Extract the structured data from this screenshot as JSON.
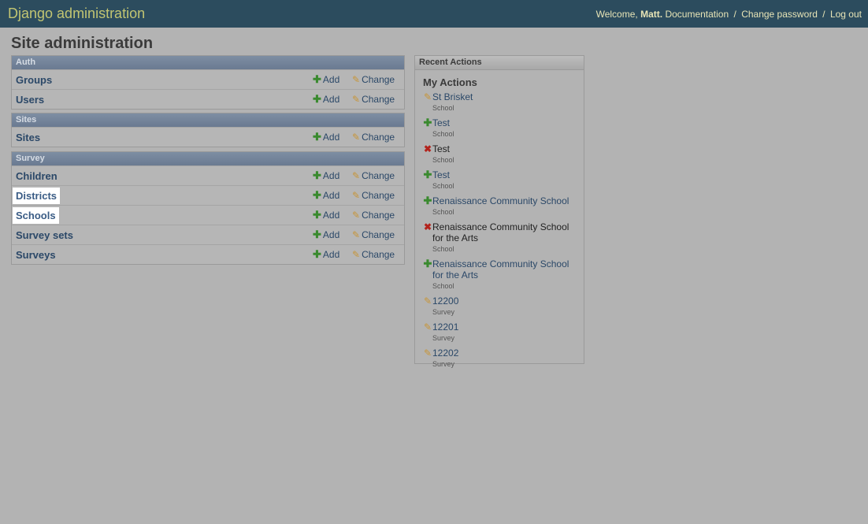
{
  "header": {
    "site_name": "Django administration",
    "welcome": "Welcome,",
    "user": "Matt.",
    "links": [
      "Documentation",
      "Change password",
      "Log out"
    ],
    "sep": "/"
  },
  "page_title": "Site administration",
  "actions": {
    "add": "Add",
    "change": "Change"
  },
  "modules": [
    {
      "caption": "Auth",
      "models": [
        "Groups",
        "Users"
      ]
    },
    {
      "caption": "Sites",
      "models": [
        "Sites"
      ]
    },
    {
      "caption": "Survey",
      "models": [
        "Children",
        "Districts",
        "Schools",
        "Survey sets",
        "Surveys"
      ]
    }
  ],
  "recent": {
    "caption": "Recent Actions",
    "heading": "My Actions",
    "items": [
      {
        "icon": "pencil-icon",
        "title": "St Brisket",
        "type": "School"
      },
      {
        "icon": "plus-icon",
        "title": "Test",
        "type": "School"
      },
      {
        "icon": "x-icon",
        "title": "Test",
        "type": "School"
      },
      {
        "icon": "plus-icon",
        "title": "Test",
        "type": "School"
      },
      {
        "icon": "plus-icon",
        "title": "Renaissance Community School",
        "type": "School"
      },
      {
        "icon": "x-icon",
        "title": "Renaissance Community School for the Arts",
        "type": "School"
      },
      {
        "icon": "plus-icon",
        "title": "Renaissance Community School for the Arts",
        "type": "School"
      },
      {
        "icon": "pencil-icon",
        "title": "12200",
        "type": "Survey"
      },
      {
        "icon": "pencil-icon",
        "title": "12201",
        "type": "Survey"
      },
      {
        "icon": "pencil-icon",
        "title": "12202",
        "type": "Survey"
      }
    ]
  }
}
